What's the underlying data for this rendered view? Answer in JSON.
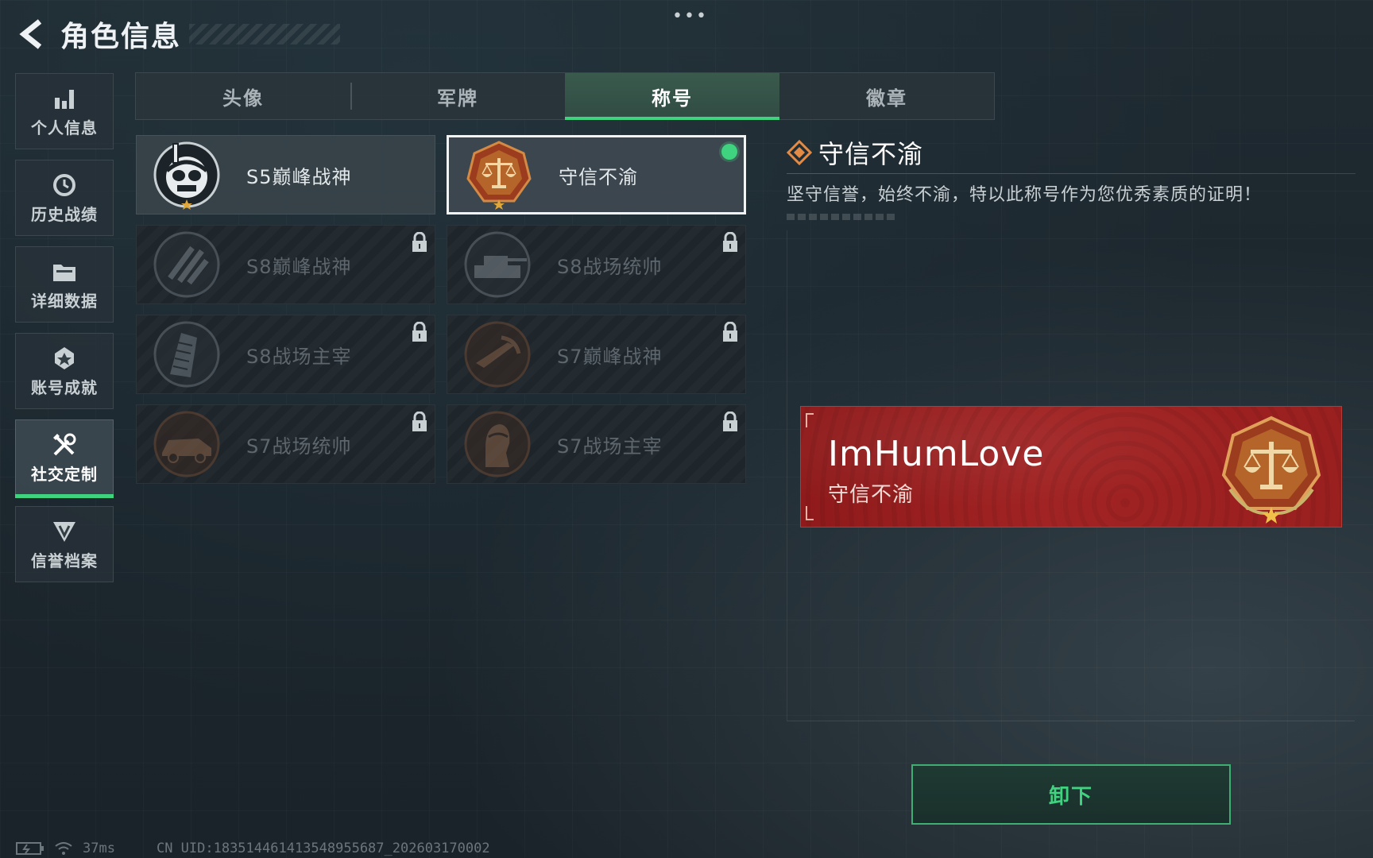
{
  "header": {
    "title": "角色信息",
    "more": "•••"
  },
  "sidebar": {
    "items": [
      {
        "label": "个人信息",
        "icon": "bar-chart-icon",
        "active": false
      },
      {
        "label": "历史战绩",
        "icon": "history-icon",
        "active": false
      },
      {
        "label": "详细数据",
        "icon": "folder-icon",
        "active": false
      },
      {
        "label": "账号成就",
        "icon": "achievement-icon",
        "active": false
      },
      {
        "label": "社交定制",
        "icon": "tools-icon",
        "active": true
      },
      {
        "label": "信誉档案",
        "icon": "credit-icon",
        "active": false
      }
    ]
  },
  "tabs": [
    {
      "label": "头像",
      "active": false
    },
    {
      "label": "军牌",
      "active": false
    },
    {
      "label": "称号",
      "active": true
    },
    {
      "label": "徽章",
      "active": false
    }
  ],
  "titles": [
    {
      "name": "S5巅峰战神",
      "locked": false,
      "selected": false,
      "emblem": "diver-skull-emblem"
    },
    {
      "name": "守信不渝",
      "locked": false,
      "selected": true,
      "equipped": true,
      "emblem": "scales-emblem"
    },
    {
      "name": "S8巅峰战神",
      "locked": true,
      "emblem": "slash-emblem"
    },
    {
      "name": "S8战场统帅",
      "locked": true,
      "emblem": "tank-emblem"
    },
    {
      "name": "S8战场主宰",
      "locked": true,
      "emblem": "building-emblem"
    },
    {
      "name": "S7巅峰战神",
      "locked": true,
      "emblem": "rifle-emblem"
    },
    {
      "name": "S7战场统帅",
      "locked": true,
      "emblem": "vehicle-emblem"
    },
    {
      "name": "S7战场主宰",
      "locked": true,
      "emblem": "soldier-emblem"
    }
  ],
  "detail": {
    "name": "守信不渝",
    "description": "坚守信誉，始终不渝，特以此称号作为您优秀素质的证明！"
  },
  "banner": {
    "player_name": "ImHumLove",
    "title": "守信不渝",
    "color": "#a12323"
  },
  "unequip_label": "卸下",
  "footer": {
    "ping": "37ms",
    "uid": "CN UID:1835144614135489556​87_202603170002"
  },
  "colors": {
    "accent_green": "#3fd37f",
    "banner_red": "#a12323",
    "emblem_bronze": "#b5652a"
  }
}
